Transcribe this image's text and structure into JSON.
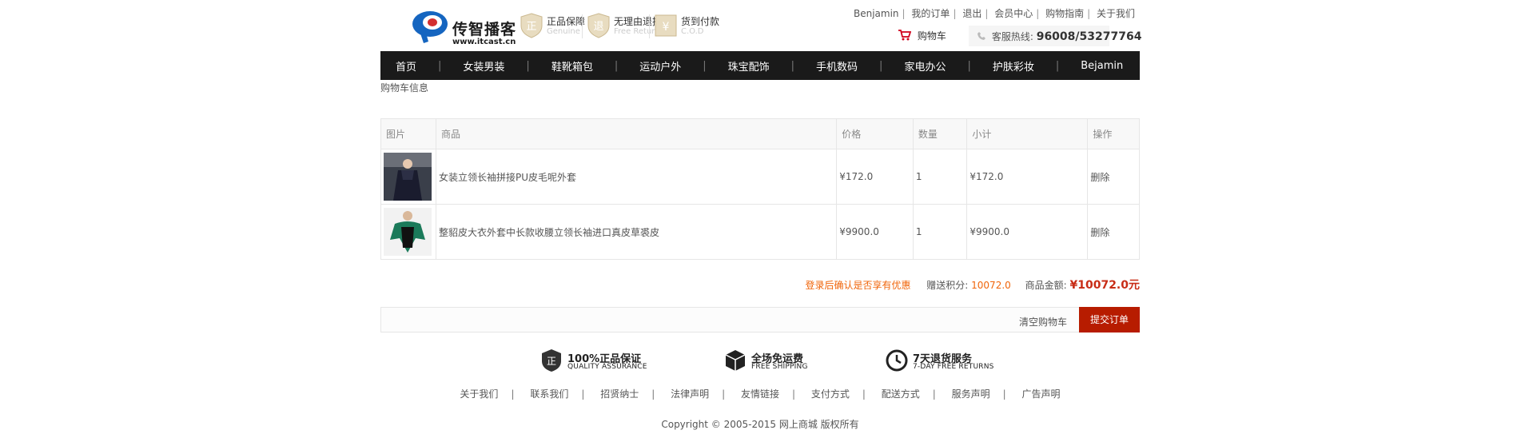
{
  "header": {
    "brand_name": "传智播客",
    "brand_domain": "www.itcast.cn",
    "promises": [
      {
        "title": "正品保障",
        "subtitle": "Genuine",
        "icon": "genuine-shield-icon"
      },
      {
        "title": "无理由退换",
        "subtitle": "Free Returns",
        "icon": "return-shield-icon"
      },
      {
        "title": "货到付款",
        "subtitle": "C.O.D",
        "icon": "cod-icon"
      }
    ],
    "top_links": [
      "Benjamin",
      "我的订单",
      "退出",
      "会员中心",
      "购物指南",
      "关于我们"
    ],
    "cart_label": "购物车",
    "hotline_label": "客服热线:",
    "hotline_number": "96008/53277764",
    "accent_color": "#b71c00"
  },
  "nav": {
    "items": [
      "首页",
      "女装男装",
      "鞋靴箱包",
      "运动户外",
      "珠宝配饰",
      "手机数码",
      "家电办公",
      "护肤彩妆",
      "Bejamin"
    ]
  },
  "section_title": "购物车信息",
  "table": {
    "headers": [
      "图片",
      "商品",
      "价格",
      "数量",
      "小计",
      "操作"
    ],
    "rows": [
      {
        "name": "女装立领长袖拼接PU皮毛呢外套",
        "price": "¥172.0",
        "qty": "1",
        "subtotal": "¥172.0",
        "action": "删除"
      },
      {
        "name": "整貂皮大衣外套中长款收腰立领长袖进口真皮草裘皮",
        "price": "¥9900.0",
        "qty": "1",
        "subtotal": "¥9900.0",
        "action": "删除"
      }
    ]
  },
  "summary": {
    "login_tip": "登录后确认是否享有优惠",
    "points_label": "赠送积分:",
    "points_value": "10072.0",
    "amount_label": "商品金额:",
    "amount_value": "¥10072.0元"
  },
  "actions": {
    "clear_label": "清空购物车",
    "submit_label": "提交订单"
  },
  "guarantees": [
    {
      "title": "100%正品保证",
      "subtitle": "QUALITY ASSURANCE",
      "icon": "quality-badge-icon"
    },
    {
      "title": "全场免运费",
      "subtitle": "FREE SHIPPING",
      "icon": "box-icon"
    },
    {
      "title": "7天退货服务",
      "subtitle": "7-DAY FREE RETURNS",
      "icon": "clock-icon"
    }
  ],
  "footer": {
    "links": [
      "关于我们",
      "联系我们",
      "招贤纳士",
      "法律声明",
      "友情链接",
      "支付方式",
      "配送方式",
      "服务声明",
      "广告声明"
    ],
    "copyright": "Copyright © 2005-2015 网上商城 版权所有"
  }
}
